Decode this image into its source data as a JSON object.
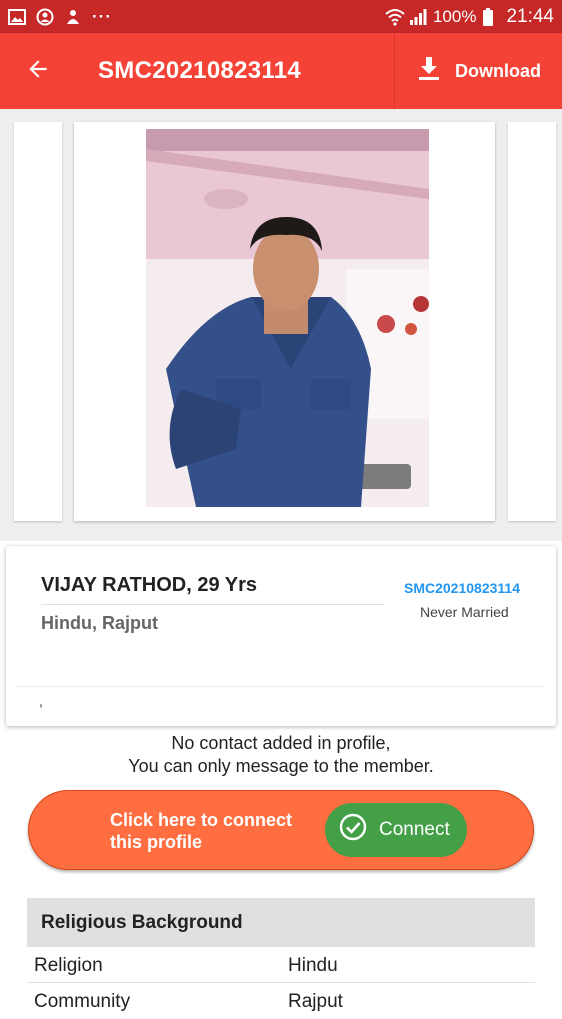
{
  "status_bar": {
    "battery": "100%",
    "time": "21:44",
    "more": "···"
  },
  "app_bar": {
    "title": "SMC20210823114",
    "download_label": "Download"
  },
  "profile": {
    "name_age": "VIJAY RATHOD, 29 Yrs",
    "religion_caste": "Hindu, Rajput",
    "id": "SMC20210823114",
    "marital_status": "Never Married",
    "location": ","
  },
  "contact": {
    "line1": "No contact added in profile,",
    "line2": "You can only message to the member."
  },
  "connect": {
    "prompt_line1": "Click here to connect",
    "prompt_line2": "this profile",
    "button_label": "Connect"
  },
  "religious_background": {
    "header": "Religious Background",
    "rows": [
      {
        "key": "Religion",
        "value": "Hindu"
      },
      {
        "key": "Community",
        "value": "Rajput"
      }
    ]
  },
  "colors": {
    "status_bar": "#c62828",
    "app_bar": "#f44336",
    "connect_banner": "#ff6e40",
    "connect_button": "#43a047",
    "id_link": "#2196f3"
  }
}
